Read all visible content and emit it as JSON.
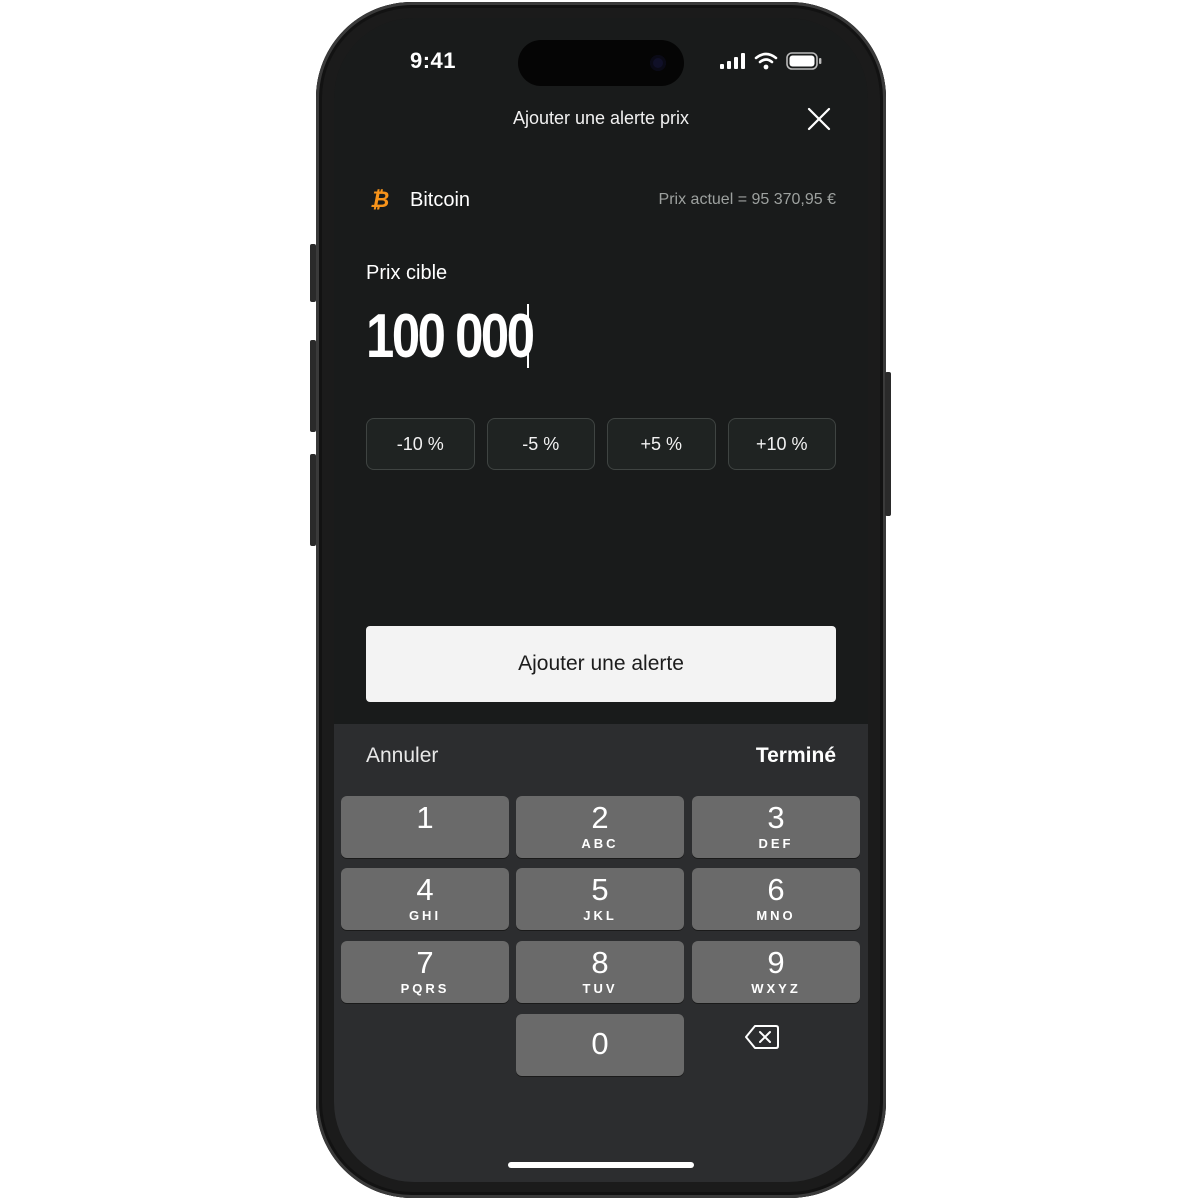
{
  "status_bar": {
    "time": "9:41"
  },
  "header": {
    "title": "Ajouter une alerte prix"
  },
  "asset": {
    "name": "Bitcoin",
    "symbol": "₿",
    "current_price": "Prix actuel = 95 370,95 €"
  },
  "target": {
    "label": "Prix cible",
    "value": "100 000"
  },
  "percent_buttons": [
    "-10 %",
    "-5 %",
    "+5 %",
    "+10 %"
  ],
  "primary_action": {
    "label": "Ajouter une alerte"
  },
  "keyboard": {
    "cancel_label": "Annuler",
    "done_label": "Terminé",
    "keys": [
      {
        "digit": "1",
        "letters": ""
      },
      {
        "digit": "2",
        "letters": "ABC"
      },
      {
        "digit": "3",
        "letters": "DEF"
      },
      {
        "digit": "4",
        "letters": "GHI"
      },
      {
        "digit": "5",
        "letters": "JKL"
      },
      {
        "digit": "6",
        "letters": "MNO"
      },
      {
        "digit": "7",
        "letters": "PQRS"
      },
      {
        "digit": "8",
        "letters": "TUV"
      },
      {
        "digit": "9",
        "letters": "WXYZ"
      },
      {
        "digit": "0",
        "letters": ""
      }
    ]
  },
  "colors": {
    "background": "#191b1b",
    "bitcoin": "#f7931a",
    "button_light": "#f3f3f3",
    "key": "#6a6a6a"
  },
  "icons": [
    "close-icon",
    "bitcoin-icon",
    "signal-icon",
    "wifi-icon",
    "battery-icon",
    "backspace-icon"
  ]
}
